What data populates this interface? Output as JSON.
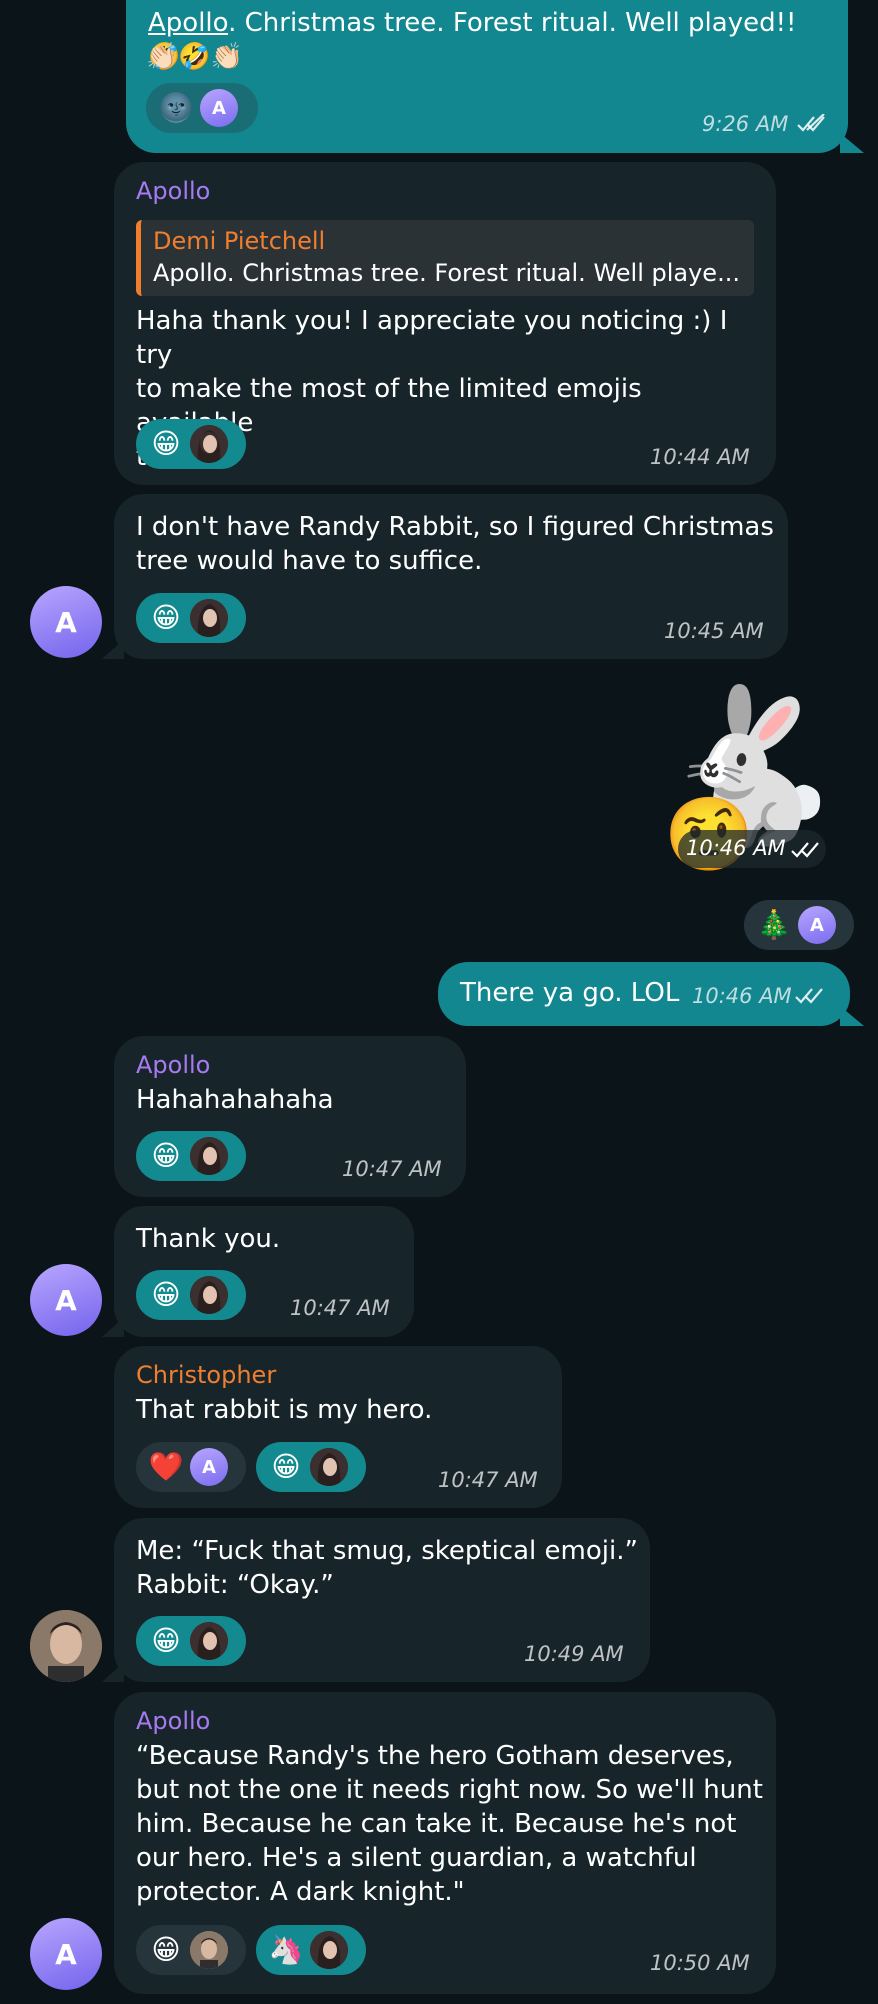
{
  "messages": {
    "m1": {
      "mention": "Apollo",
      "text": ". Christmas tree. Forest ritual. Well played!! 🤣",
      "text2": "👏🏻🤣👏🏻",
      "reactions": [
        "🌚"
      ],
      "reactor": "A",
      "time": "9:26 AM"
    },
    "m2": {
      "sender": "Apollo",
      "quote_author": "Demi Pietchell",
      "quote_text": "Apollo. Christmas tree. Forest ritual. Well playe...",
      "lines": [
        "Haha thank you! I appreciate you noticing :) I try",
        "to make the most of the limited emojis available",
        "to me."
      ],
      "reaction": "😁",
      "time": "10:44 AM"
    },
    "m3": {
      "lines": [
        "I don't have Randy Rabbit, so I figured Christmas",
        "tree would have to suffice."
      ],
      "reaction": "😁",
      "time": "10:45 AM",
      "avatar": "A"
    },
    "m4": {
      "sticker": "🐇",
      "sticker2": "🤨",
      "time": "10:46 AM",
      "reaction": "🎄",
      "reactor": "A"
    },
    "m5": {
      "text": "There ya go. LOL",
      "time": "10:46 AM"
    },
    "m6": {
      "sender": "Apollo",
      "text": "Hahahahahaha",
      "reaction": "😁",
      "time": "10:47 AM"
    },
    "m7": {
      "text": "Thank you.",
      "reaction": "😁",
      "time": "10:47 AM",
      "avatar": "A"
    },
    "m8": {
      "sender": "Christopher",
      "text": "That rabbit is my hero.",
      "reaction1": "❤️",
      "reactor1": "A",
      "reaction2": "😁",
      "time": "10:47 AM"
    },
    "m9": {
      "lines": [
        "Me: “Fuck that smug, skeptical emoji.”",
        "Rabbit: “Okay.”"
      ],
      "reaction": "😁",
      "time": "10:49 AM"
    },
    "m10": {
      "sender": "Apollo",
      "lines": [
        "“Because Randy's the hero Gotham deserves,",
        "but not the one it needs right now. So we'll hunt",
        "him. Because he can take it. Because he's not",
        "our hero. He's a silent guardian, a watchful",
        "protector. A dark knight.\""
      ],
      "reaction1": "😁",
      "reaction2": "🦄",
      "time": "10:50 AM",
      "avatar": "A"
    }
  },
  "colors": {
    "background": "#0b1418",
    "incoming": "#17252b",
    "outgoing": "#12878f",
    "apollo": "#a77bf0",
    "orange": "#ef7f2f"
  }
}
